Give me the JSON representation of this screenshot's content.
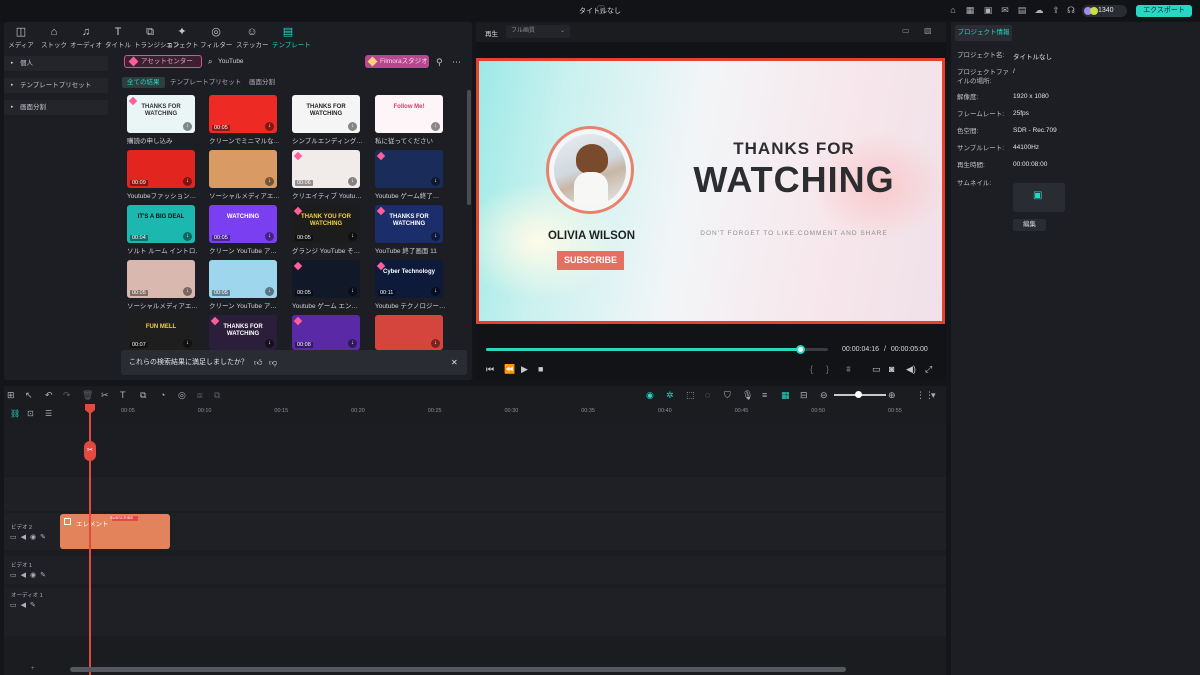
{
  "window": {
    "title": "タイトルなし",
    "credits": "1340",
    "export_label": "エクスポート"
  },
  "categories": [
    {
      "label": "メディア",
      "icon": "media-icon"
    },
    {
      "label": "ストック",
      "icon": "stock-icon"
    },
    {
      "label": "オーディオ",
      "icon": "audio-icon"
    },
    {
      "label": "タイトル",
      "icon": "title-icon"
    },
    {
      "label": "トランジション",
      "icon": "transition-icon"
    },
    {
      "label": "エフェクト",
      "icon": "effect-icon"
    },
    {
      "label": "フィルター",
      "icon": "filter-icon"
    },
    {
      "label": "ステッカー",
      "icon": "sticker-icon"
    },
    {
      "label": "テンプレート",
      "icon": "template-icon",
      "active": true
    }
  ],
  "sidebar": {
    "items": [
      {
        "label": "個人"
      },
      {
        "label": "テンプレートプリセット"
      },
      {
        "label": "画面分割"
      }
    ]
  },
  "toolbar": {
    "asset_center": "アセットセンター",
    "search_value": "YouTube",
    "filmora_studio": "Filmoraスタジオ"
  },
  "subtabs": [
    {
      "label": "全ての結果",
      "active": true
    },
    {
      "label": "テンプレートプリセット"
    },
    {
      "label": "画面分割"
    }
  ],
  "templates": [
    {
      "caption": "購読の申し込み",
      "art": "THANKS FOR WATCHING",
      "bg": "#eaf6f6",
      "fg": "#333",
      "duration": "",
      "premium": true
    },
    {
      "caption": "クリーンでミニマルな…",
      "art": "",
      "bg": "#ee2a24",
      "fg": "#fff",
      "duration": "00:05",
      "premium": false
    },
    {
      "caption": "シンプルエンディング…",
      "art": "THANKS FOR WATCHING",
      "bg": "#f5f5f5",
      "fg": "#222",
      "duration": "",
      "premium": false
    },
    {
      "caption": "私に従ってください",
      "art": "Follow Me!",
      "bg": "#fdf5f7",
      "fg": "#e03a62",
      "duration": "",
      "premium": false
    },
    {
      "caption": "Youtubeファッション…",
      "art": "",
      "bg": "#e3251f",
      "fg": "#fff",
      "duration": "00:09",
      "premium": false
    },
    {
      "caption": "ソーシャルメディアエ…",
      "art": "",
      "bg": "#d99a63",
      "fg": "#fff",
      "duration": "",
      "premium": false
    },
    {
      "caption": "クリエイティブ Youtu…",
      "art": "",
      "bg": "#f1ece9",
      "fg": "#d22",
      "duration": "00:06",
      "premium": true
    },
    {
      "caption": "Youtube ゲーム終了…",
      "art": "",
      "bg": "#1a2c5a",
      "fg": "#fff",
      "duration": "",
      "premium": true
    },
    {
      "caption": "ソルト ルーム イントロ…",
      "art": "IT'S A BIG DEAL",
      "bg": "#1cb8b0",
      "fg": "#111",
      "duration": "00:04",
      "premium": false
    },
    {
      "caption": "クリーン YouTube ア…",
      "art": "WATCHING",
      "bg": "#7b3ff2",
      "fg": "#fff",
      "duration": "00:05",
      "premium": false
    },
    {
      "caption": "グランジ YouTube そ…",
      "art": "THANK YOU FOR WATCHING",
      "bg": "#1c1c1c",
      "fg": "#f6d33b",
      "duration": "00:05",
      "premium": true
    },
    {
      "caption": "YouTube 終了画面 11",
      "art": "THANKS FOR WATCHING",
      "bg": "#1b2d6b",
      "fg": "#fff",
      "duration": "",
      "premium": true
    },
    {
      "caption": "ソーシャルメディアエ…",
      "art": "",
      "bg": "#d9b8b0",
      "fg": "#222",
      "duration": "00:05",
      "premium": false
    },
    {
      "caption": "クリーン YouTube ア…",
      "art": "",
      "bg": "#9ed6ee",
      "fg": "#fff",
      "duration": "00:05",
      "premium": false
    },
    {
      "caption": "Youtube ゲーム エン…",
      "art": "",
      "bg": "#111827",
      "fg": "#fff",
      "duration": "00:05",
      "premium": true
    },
    {
      "caption": "Youtube テクノロジー…",
      "art": "Cyber Technology",
      "bg": "#0e1a3a",
      "fg": "#fff",
      "duration": "00:11",
      "premium": true
    },
    {
      "caption": "",
      "art": "FUN MELL",
      "bg": "#1e1e1e",
      "fg": "#f6d33b",
      "duration": "00:07",
      "premium": false
    },
    {
      "caption": "",
      "art": "THANKS FOR WATCHING",
      "bg": "#2b1e3a",
      "fg": "#fff",
      "duration": "",
      "premium": true
    },
    {
      "caption": "",
      "art": "",
      "bg": "#5a2aa6",
      "fg": "#fff",
      "duration": "00:08",
      "premium": true
    },
    {
      "caption": "",
      "art": "",
      "bg": "#d6453d",
      "fg": "#fff",
      "duration": "",
      "premium": false
    }
  ],
  "feedback": {
    "question": "これらの検索結果に満足しましたか？"
  },
  "player": {
    "label": "再生",
    "quality": "フル画質",
    "current_time": "00:00:04:16",
    "separator": "/",
    "total_time": "00:00:05:00",
    "progress": 0.92
  },
  "preview": {
    "thanks": "THANKS FOR",
    "watching": "WATCHING",
    "name": "OLIVIA WILSON",
    "subscribe": "SUBSCRIBE",
    "tagline": "DON'T FORGET TO LIKE.COMMENT AND SHARE"
  },
  "props": {
    "tab": "プロジェクト情報",
    "rows": [
      {
        "label": "プロジェクト名:",
        "value": "タイトルなし"
      },
      {
        "label": "プロジェクトファイルの場所:",
        "value": "/"
      },
      {
        "label": "解像度:",
        "value": "1920 x 1080"
      },
      {
        "label": "フレームレート:",
        "value": "25fps"
      },
      {
        "label": "色空間:",
        "value": "SDR - Rec.709"
      },
      {
        "label": "サンプルレート:",
        "value": "44100Hz"
      },
      {
        "label": "再生時間:",
        "value": "00:00:08:00"
      },
      {
        "label": "サムネイル:",
        "value": ""
      }
    ],
    "edit_label": "編集"
  },
  "timeline": {
    "ticks": [
      "00:05",
      "00:10",
      "00:15",
      "00:20",
      "00:25",
      "00:30",
      "00:35",
      "00:40",
      "00:45",
      "00:50",
      "00:55"
    ],
    "tracks": [
      {
        "name": "ビデオ 2"
      },
      {
        "name": "ビデオ 1"
      },
      {
        "name": "オーディオ 1"
      }
    ],
    "clip_label": "エレメント",
    "clip_tag": "SUBSCRIBE"
  },
  "colors": {
    "accent": "#27d7c4",
    "playhead": "#e24a3f",
    "preview_border": "#e7402d"
  }
}
